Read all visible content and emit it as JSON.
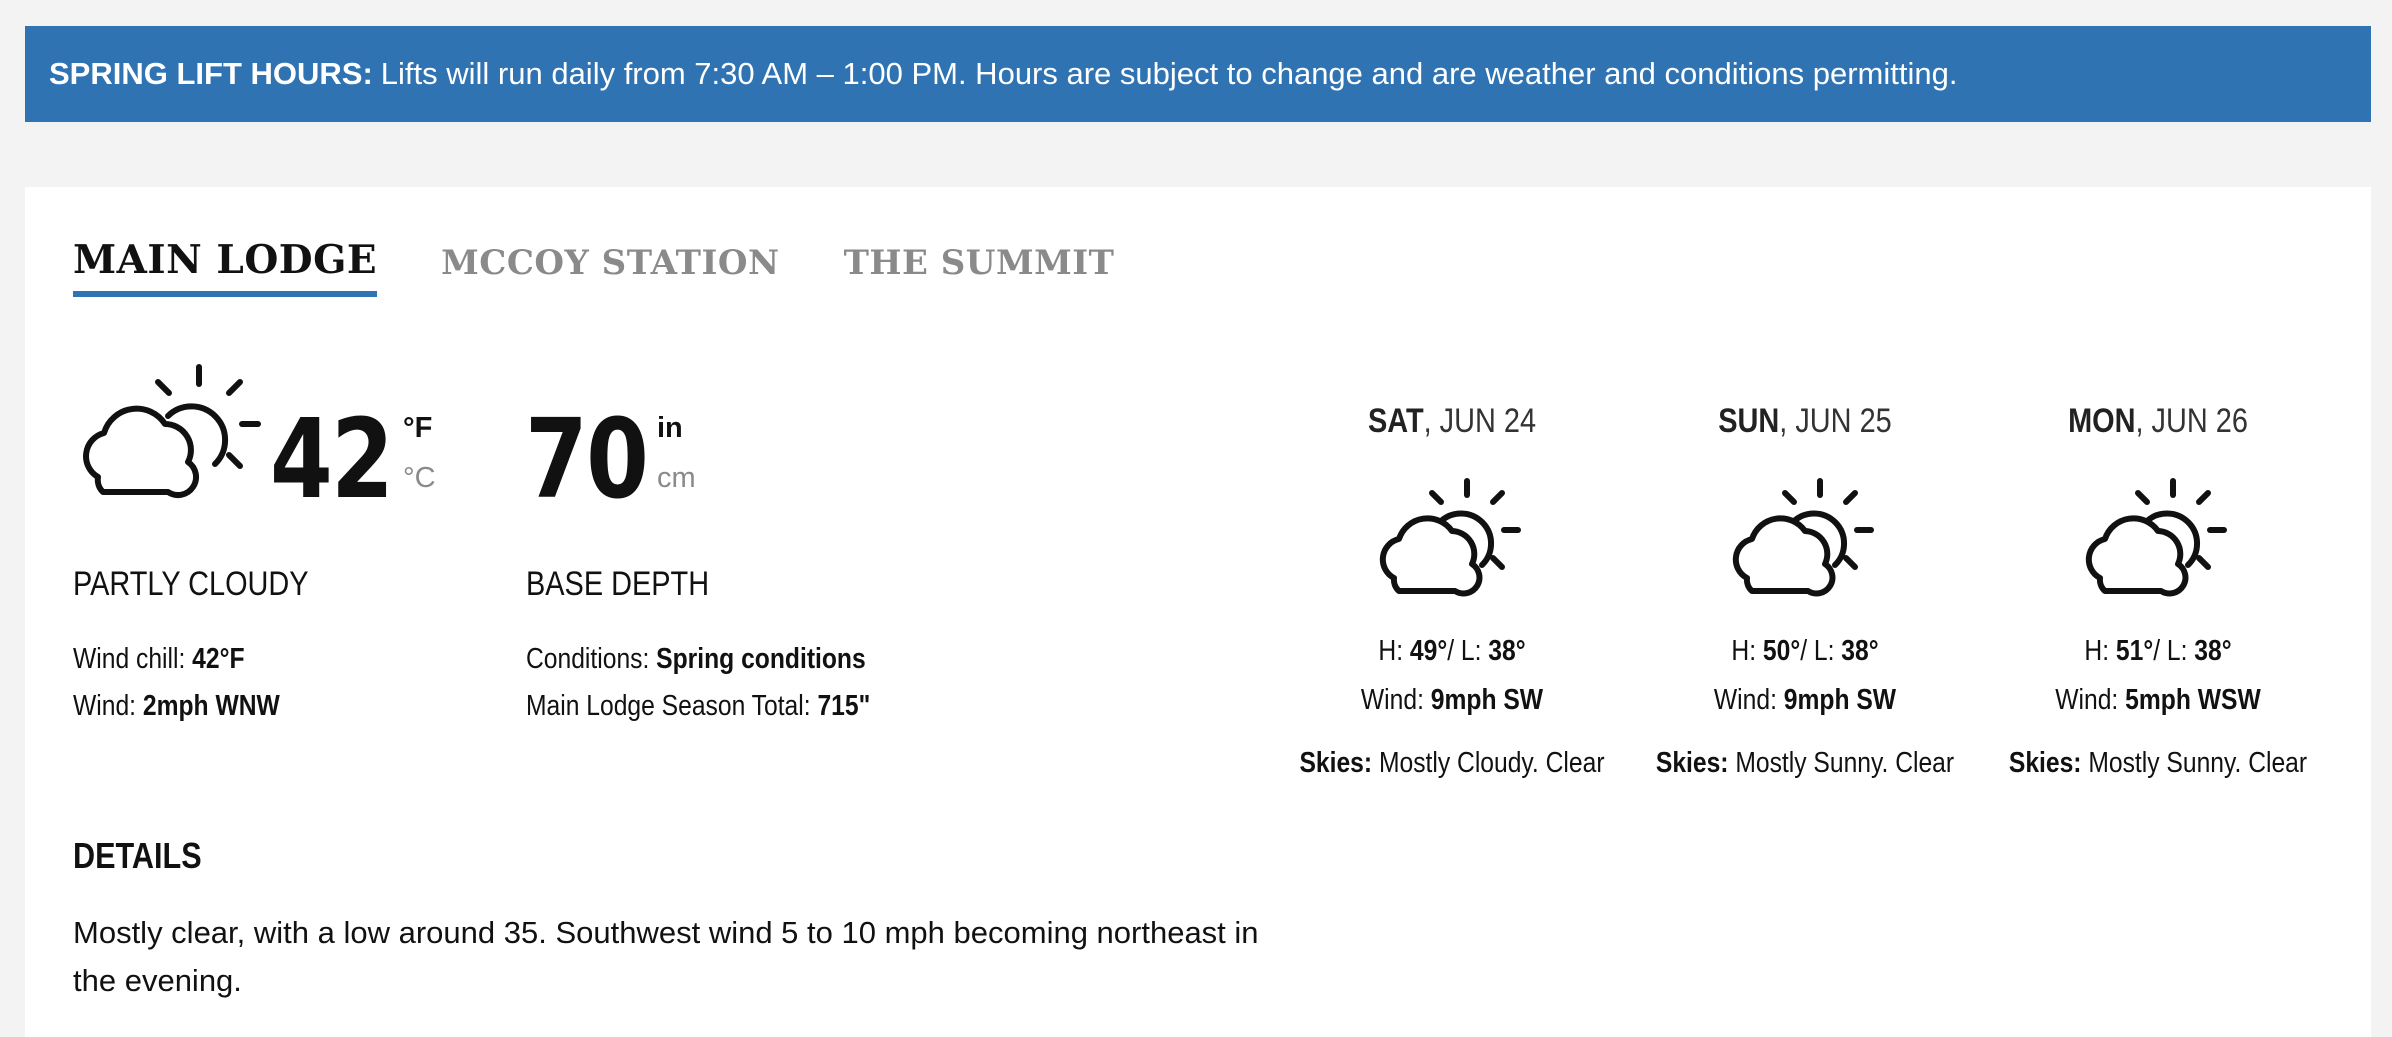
{
  "banner": {
    "label": "SPRING LIFT HOURS:",
    "text": "Lifts will run daily from 7:30 AM – 1:00 PM. Hours are subject to change and are weather and conditions permitting."
  },
  "tabs": [
    "MAIN LODGE",
    "MCCOY STATION",
    "THE SUMMIT"
  ],
  "current": {
    "icon": "partly-cloudy-icon",
    "temperature": "42",
    "unit_primary": "°F",
    "unit_secondary": "°C",
    "condition": "PARTLY CLOUDY",
    "wind_chill_label": "Wind chill:",
    "wind_chill_value": "42°F",
    "wind_label": "Wind:",
    "wind_value": "2mph WNW"
  },
  "snow": {
    "depth": "70",
    "unit_primary": "in",
    "unit_secondary": "cm",
    "title": "BASE DEPTH",
    "conditions_label": "Conditions:",
    "conditions_value": "Spring conditions",
    "season_label": "Main Lodge Season Total:",
    "season_value": "715\""
  },
  "details": {
    "title": "DETAILS",
    "text": "Mostly clear, with a low around 35. Southwest wind 5 to 10 mph becoming northeast in the evening."
  },
  "forecast": [
    {
      "day": "SAT",
      "date": ", JUN 24",
      "icon": "partly-cloudy-icon",
      "high": "49°",
      "low": "38°",
      "wind": "9mph SW",
      "skies": "Mostly Cloudy. Clear"
    },
    {
      "day": "SUN",
      "date": ", JUN 25",
      "icon": "partly-cloudy-icon",
      "high": "50°",
      "low": "38°",
      "wind": "9mph SW",
      "skies": "Mostly Sunny. Clear"
    },
    {
      "day": "MON",
      "date": ", JUN 26",
      "icon": "partly-cloudy-icon",
      "high": "51°",
      "low": "38°",
      "wind": "5mph WSW",
      "skies": "Mostly Sunny. Clear"
    }
  ],
  "labels": {
    "high": "H:",
    "sep": "/ L:",
    "wind": "Wind:",
    "skies": "Skies:"
  },
  "colors": {
    "accent": "#2f73b3",
    "background": "#f3f3f3",
    "muted": "#8a8a8a"
  }
}
